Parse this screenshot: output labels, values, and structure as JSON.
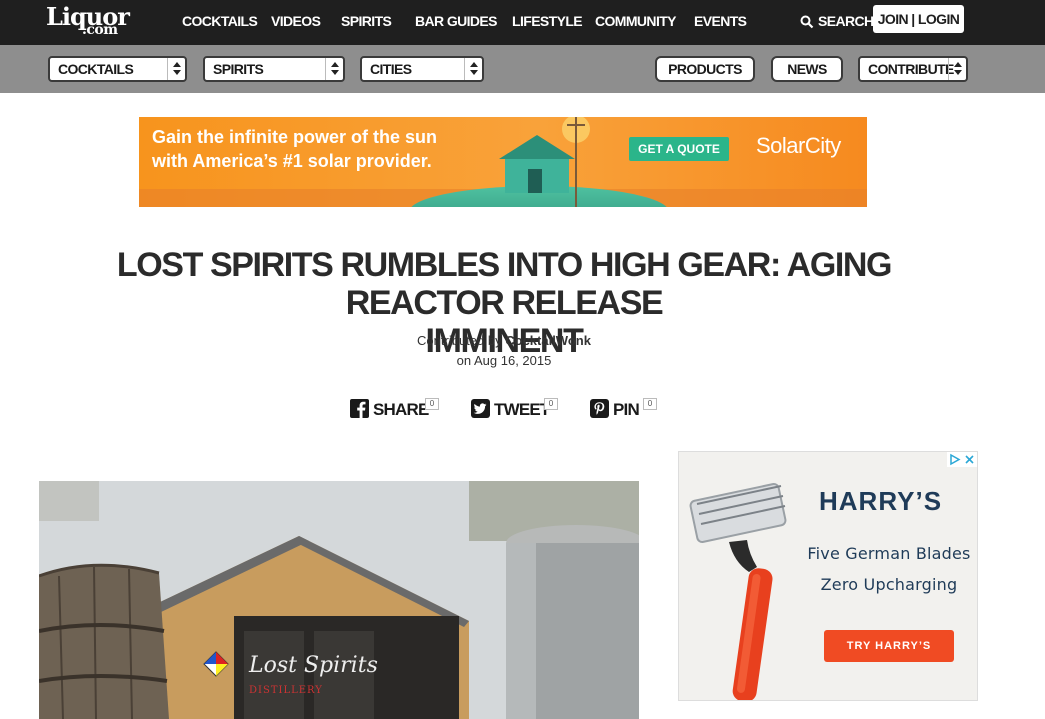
{
  "site": {
    "logo_top": "Liquor",
    "logo_bottom": ".com"
  },
  "nav": {
    "items": [
      "COCKTAILS",
      "VIDEOS",
      "SPIRITS",
      "BAR GUIDES",
      "LIFESTYLE",
      "COMMUNITY",
      "EVENTS"
    ],
    "search_label": "SEARCH",
    "join_label": "JOIN | LOGIN"
  },
  "subnav": {
    "selects": [
      "COCKTAILS",
      "SPIRITS",
      "CITIES"
    ],
    "buttons": [
      "PRODUCTS",
      "NEWS"
    ],
    "contribute_label": "CONTRIBUTE"
  },
  "banner_ad": {
    "line1": "Gain the infinite power of the sun",
    "line2": "with America’s #1 solar provider.",
    "cta": "GET A QUOTE",
    "brand": "SolarCity"
  },
  "article": {
    "title_line1": "LOST SPIRITS RUMBLES INTO HIGH GEAR: AGING REACTOR RELEASE",
    "title_line2": "IMMINENT",
    "contributed_prefix": "Contributed by",
    "author": "CocktailWonk",
    "date": "on Aug 16, 2015"
  },
  "share": {
    "facebook": {
      "label": "SHARE",
      "count": "0"
    },
    "twitter": {
      "label": "TWEET",
      "count": "0"
    },
    "pinterest": {
      "label": "PIN",
      "count": "0"
    }
  },
  "hero": {
    "sign_text": "Lost Spirits",
    "sign_sub": "DISTILLERY"
  },
  "side_ad": {
    "brand": "HARRY’S",
    "line1": "Five German Blades",
    "line2": "Zero Upcharging",
    "cta": "TRY HARRY’S"
  },
  "colors": {
    "nav_bg": "#1f1f1f",
    "subnav_bg": "#8e8e8e",
    "banner_orange": "#f7941d",
    "cta_green": "#2bb58a",
    "harrys_navy": "#1f3b58",
    "harrys_cta": "#f04b23"
  }
}
